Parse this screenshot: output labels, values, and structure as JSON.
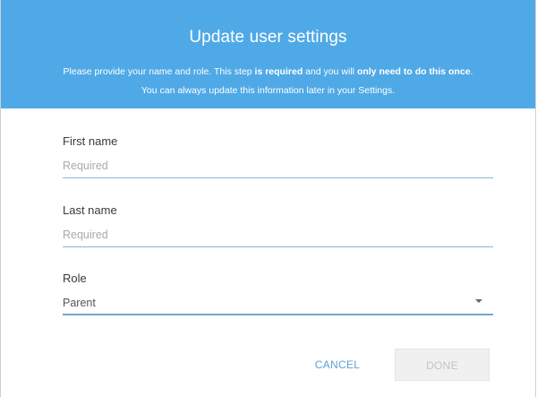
{
  "dialog": {
    "title": "Update user settings",
    "subtitle": {
      "part1": "Please provide your name and role. This step ",
      "bold1": "is required",
      "part2": " and you will ",
      "bold2": "only need to do this once",
      "part3": ".",
      "line2": "You can always update this information later in your Settings."
    },
    "header_color": "#4fa9e6"
  },
  "form": {
    "first_name": {
      "label": "First name",
      "placeholder": "Required",
      "value": ""
    },
    "last_name": {
      "label": "Last name",
      "placeholder": "Required",
      "value": ""
    },
    "role": {
      "label": "Role",
      "selected": "Parent",
      "icon": "dropdown-arrow-icon"
    }
  },
  "actions": {
    "cancel_label": "CANCEL",
    "done_label": "DONE",
    "done_disabled": true
  }
}
